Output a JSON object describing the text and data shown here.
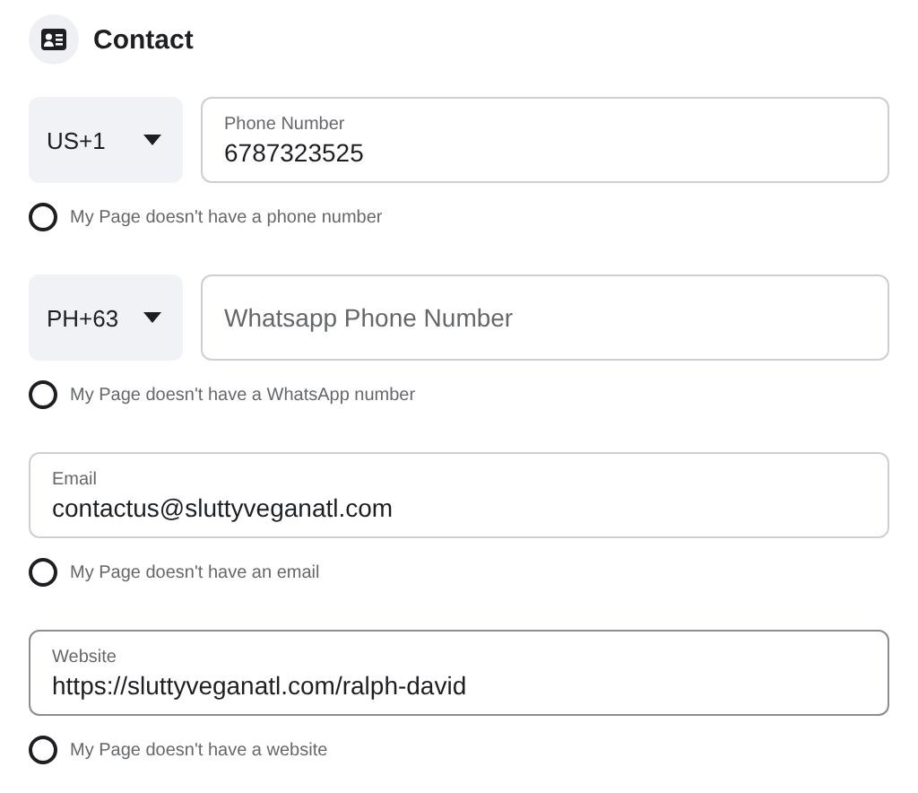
{
  "section": {
    "title": "Contact"
  },
  "fields": [
    {
      "kind": "phone",
      "country": "US+1",
      "label": "Phone Number",
      "value": "6787323525",
      "focused": false,
      "checkbox": {
        "label": "My Page doesn't have a phone number",
        "checked": false
      }
    },
    {
      "kind": "phone",
      "country": "PH+63",
      "placeholder": "Whatsapp Phone Number",
      "focused": false,
      "checkbox": {
        "label": "My Page doesn't have a WhatsApp number",
        "checked": false
      }
    },
    {
      "kind": "text",
      "label": "Email",
      "value": "contactus@sluttyveganatl.com",
      "focused": false,
      "checkbox": {
        "label": "My Page doesn't have an email",
        "checked": false
      }
    },
    {
      "kind": "text",
      "label": "Website",
      "value": "https://sluttyveganatl.com/ralph-david",
      "focused": true,
      "checkbox": {
        "label": "My Page doesn't have a website",
        "checked": false
      }
    }
  ]
}
